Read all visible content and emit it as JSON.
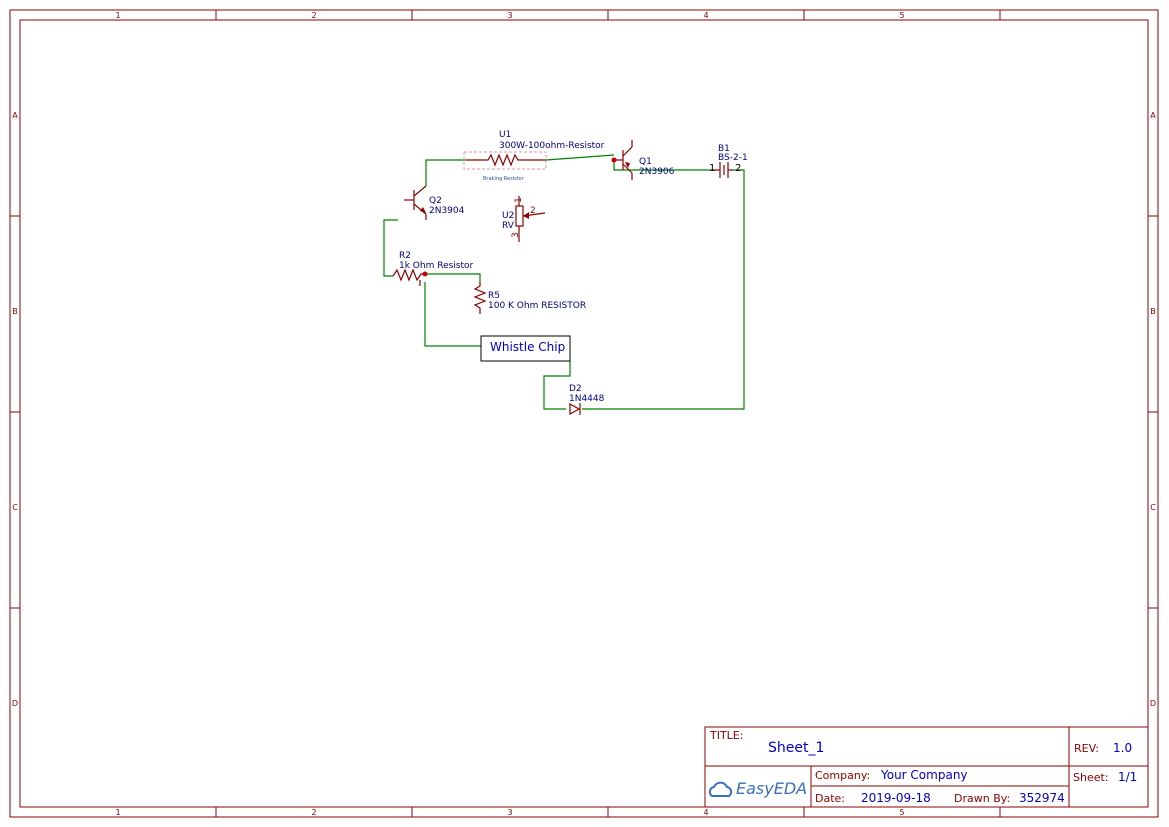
{
  "frame": {
    "columns": [
      "1",
      "2",
      "3",
      "4",
      "5"
    ],
    "rows": [
      "A",
      "B",
      "C",
      "D"
    ]
  },
  "components": {
    "u1": {
      "ref": "U1",
      "value": "300W-100ohm-Resistor",
      "note": "Braking Resistor"
    },
    "q1": {
      "ref": "Q1",
      "value": "2N3906"
    },
    "b1": {
      "ref": "B1",
      "value": "BS-2-1",
      "pin1": "1",
      "pin2": "2"
    },
    "q2": {
      "ref": "Q2",
      "value": "2N3904"
    },
    "u2": {
      "ref": "U2",
      "value": "RV",
      "pin1": "1",
      "pin2": "2",
      "pin3": "3"
    },
    "r2": {
      "ref": "R2",
      "value": "1k Ohm Resistor"
    },
    "r5": {
      "ref": "R5",
      "value": "100 K Ohm RESISTOR"
    },
    "chip": {
      "label": "Whistle Chip"
    },
    "d2": {
      "ref": "D2",
      "value": "1N4448"
    }
  },
  "title_block": {
    "title_key": "TITLE:",
    "title": "Sheet_1",
    "rev_key": "REV:",
    "rev": "1.0",
    "company_key": "Company:",
    "company": "Your Company",
    "sheet_key": "Sheet:",
    "sheet": "1/1",
    "date_key": "Date:",
    "date": "2019-09-18",
    "drawn_key": "Drawn By:",
    "drawn": "352974",
    "logo": "EasyEDA"
  }
}
